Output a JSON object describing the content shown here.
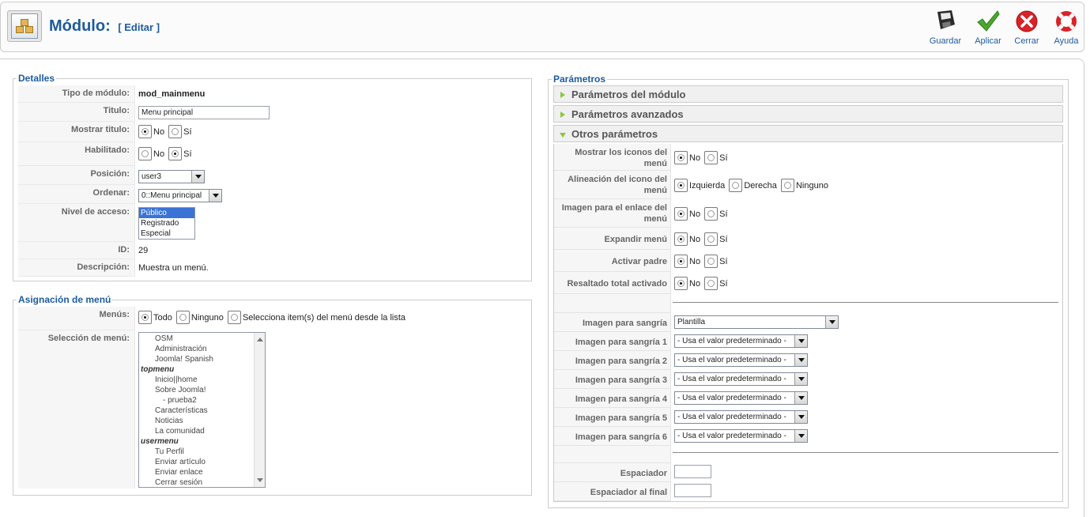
{
  "header": {
    "title": "Módulo:",
    "subtitle": "[ Editar ]",
    "buttons": [
      {
        "label": "Guardar",
        "icon": "save-icon"
      },
      {
        "label": "Aplicar",
        "icon": "apply-icon"
      },
      {
        "label": "Cerrar",
        "icon": "close-icon"
      },
      {
        "label": "Ayuda",
        "icon": "help-icon"
      }
    ]
  },
  "details": {
    "legend": "Detalles",
    "tipo_label": "Tipo de módulo:",
    "tipo_value": "mod_mainmenu",
    "titulo_label": "Titulo:",
    "titulo_value": "Menu principal",
    "mostrar_label": "Mostrar titulo:",
    "habilitado_label": "Habilitado:",
    "no": "No",
    "si": "Sí",
    "posicion_label": "Posición:",
    "posicion_value": "user3",
    "ordenar_label": "Ordenar:",
    "ordenar_value": "0::Menu principal",
    "nivel_label": "Nivel de acceso:",
    "nivel_options": [
      "Público",
      "Registrado",
      "Especial"
    ],
    "id_label": "ID:",
    "id_value": "29",
    "descripcion_label": "Descripción:",
    "descripcion_value": "Muestra un menú."
  },
  "assign": {
    "legend": "Asignación de menú",
    "menus_label": "Menús:",
    "todo": "Todo",
    "ninguno": "Ninguno",
    "selecciona": "Selecciona item(s) del menú desde la lista",
    "seleccion_label": "Selección de menú:",
    "items": [
      {
        "text": "OSM",
        "type": "opt"
      },
      {
        "text": "Administración",
        "type": "opt"
      },
      {
        "text": "Joomla! Spanish",
        "type": "opt"
      },
      {
        "text": "topmenu",
        "type": "grp"
      },
      {
        "text": "Inicio||home",
        "type": "opt"
      },
      {
        "text": "Sobre Joomla!",
        "type": "opt"
      },
      {
        "text": "- prueba2",
        "type": "sub2"
      },
      {
        "text": "Características",
        "type": "opt"
      },
      {
        "text": "Noticias",
        "type": "opt"
      },
      {
        "text": "La comunidad",
        "type": "opt"
      },
      {
        "text": "usermenu",
        "type": "grp"
      },
      {
        "text": "Tu Perfil",
        "type": "opt"
      },
      {
        "text": "Enviar artículo",
        "type": "opt"
      },
      {
        "text": "Enviar enlace",
        "type": "opt"
      },
      {
        "text": "Cerrar sesión",
        "type": "opt"
      }
    ]
  },
  "params": {
    "legend": "Parámetros",
    "panel1": "Parámetros del módulo",
    "panel2": "Parámetros avanzados",
    "panel3": "Otros parámetros",
    "no": "No",
    "si": "Sí",
    "iconos_label": "Mostrar los iconos del menú",
    "alineacion_label": "Alineación del icono del menú",
    "izquierda": "Izquierda",
    "derecha": "Derecha",
    "ninguno": "Ninguno",
    "imagen_enlace_label": "Imagen para el enlace del menú",
    "expandir_label": "Expandir menú",
    "activar_label": "Activar padre",
    "resaltado_label": "Resaltado total activado",
    "sangria_label": "Imagen para sangría",
    "sangria_value": "Plantilla",
    "sangria1_label": "Imagen para sangría 1",
    "sangria2_label": "Imagen para sangría 2",
    "sangria3_label": "Imagen para sangría 3",
    "sangria4_label": "Imagen para sangría 4",
    "sangria5_label": "Imagen para sangría 5",
    "sangria6_label": "Imagen para sangría 6",
    "default_value": "- Usa el valor predeterminado -",
    "espaciador_label": "Espaciador",
    "espaciador_final_label": "Espaciador al final"
  }
}
